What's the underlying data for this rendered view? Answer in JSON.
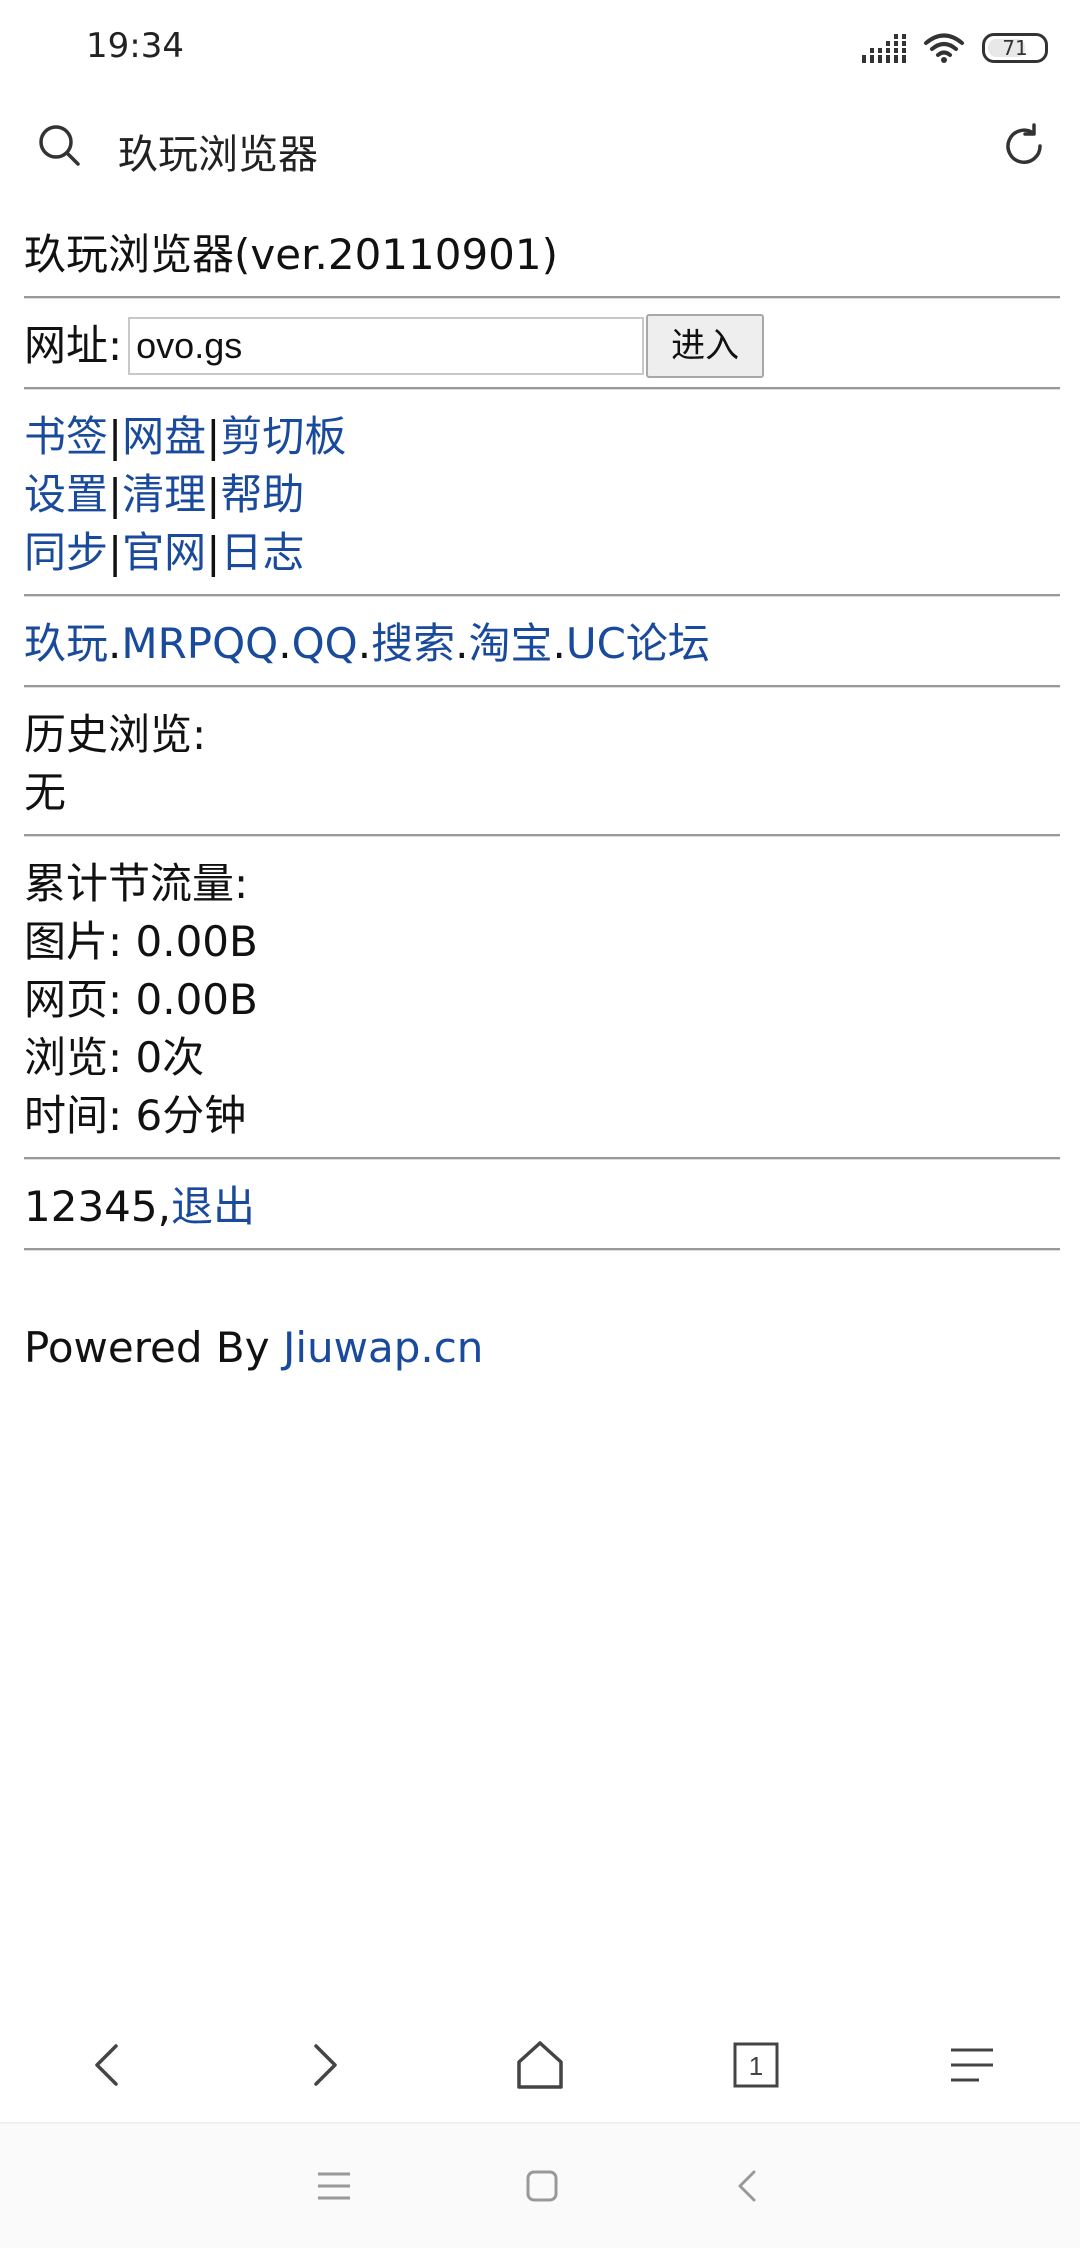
{
  "status": {
    "time": "19:34",
    "battery": "71",
    "battery_level": 0.71
  },
  "search": {
    "text": "玖玩浏览器"
  },
  "page": {
    "title": "玖玩浏览器(ver.20110901)",
    "url_label": "网址:",
    "url_value": "ovo.gs",
    "enter_label": "进入",
    "menu_rows": [
      [
        "书签",
        "网盘",
        "剪切板"
      ],
      [
        "设置",
        "清理",
        "帮助"
      ],
      [
        "同步",
        "官网",
        "日志"
      ]
    ],
    "menu_sep": "|",
    "quick_links": [
      "玖玩",
      "MRPQQ",
      "QQ",
      "搜索",
      "淘宝",
      "UC论坛"
    ],
    "quick_sep": ".",
    "history_label": "历史浏览:",
    "history_value": "无",
    "traffic_label": "累计节流量:",
    "stats": [
      {
        "label": "图片:",
        "value": "0.00B"
      },
      {
        "label": "网页:",
        "value": "0.00B"
      },
      {
        "label": "浏览:",
        "value": "0次"
      },
      {
        "label": "时间:",
        "value": "6分钟"
      }
    ],
    "user_id": "12345,",
    "logout_label": "退出",
    "powered_prefix": "Powered By ",
    "powered_link": "Jiuwap.cn"
  },
  "browser_nav": {
    "tab_count": "1"
  },
  "colors": {
    "link": "#1a4a9c",
    "divider": "#999999"
  }
}
